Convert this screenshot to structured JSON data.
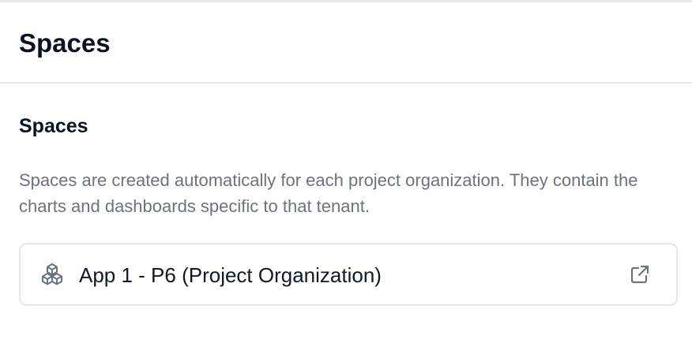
{
  "header": {
    "title": "Spaces"
  },
  "section": {
    "title": "Spaces",
    "description": "Spaces are created automatically for each project organization. They contain the charts and dashboards specific to that tenant."
  },
  "spaces": [
    {
      "label": "App 1 - P6 (Project Organization)",
      "icon": "cubes-icon",
      "action_icon": "external-link-icon"
    }
  ],
  "colors": {
    "text_primary": "#111827",
    "text_secondary": "#6b7280",
    "border": "#e5e7eb",
    "icon": "#6b7280"
  }
}
